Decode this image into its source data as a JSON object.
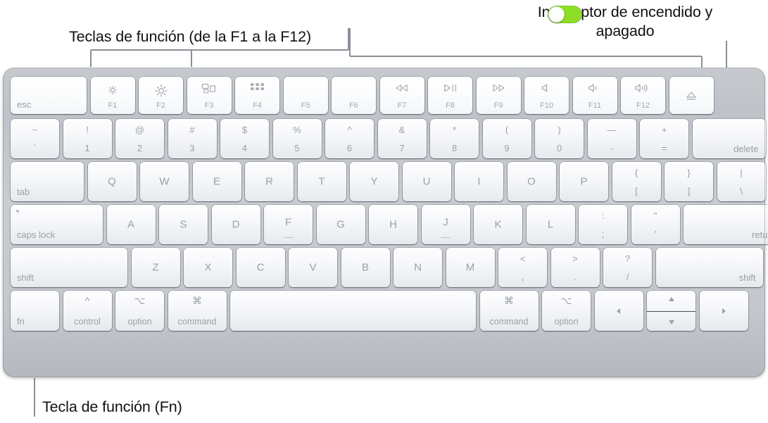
{
  "callouts": {
    "function_keys": "Teclas de función (de la F1 a la F12)",
    "power_switch": "Interruptor de encendido y apagado",
    "fn_key": "Tecla de función (Fn)"
  },
  "toggle": {
    "state": "on",
    "accent_color": "#8ede28",
    "knob_color": "#fdfdfd"
  },
  "colors": {
    "body_top": "#c6c9ce",
    "body_bottom": "#b4b8bf",
    "key_face": "#f7f8fa",
    "key_text": "#9aa0a8",
    "callout_text": "#111111",
    "leader_line": "#8a8f96"
  },
  "keyboard": {
    "rows": [
      {
        "name": "function-row",
        "keys": [
          {
            "id": "esc",
            "label": "esc",
            "style": "bottom-left"
          },
          {
            "id": "f1",
            "icon": "brightness-down-icon",
            "sub": "F1"
          },
          {
            "id": "f2",
            "icon": "brightness-up-icon",
            "sub": "F2"
          },
          {
            "id": "f3",
            "icon": "mission-control-icon",
            "sub": "F3"
          },
          {
            "id": "f4",
            "icon": "launchpad-icon",
            "sub": "F4"
          },
          {
            "id": "f5",
            "icon": "",
            "sub": "F5"
          },
          {
            "id": "f6",
            "icon": "",
            "sub": "F6"
          },
          {
            "id": "f7",
            "icon": "rewind-icon",
            "sub": "F7"
          },
          {
            "id": "f8",
            "icon": "play-pause-icon",
            "sub": "F8"
          },
          {
            "id": "f9",
            "icon": "fast-forward-icon",
            "sub": "F9"
          },
          {
            "id": "f10",
            "icon": "mute-icon",
            "sub": "F10"
          },
          {
            "id": "f11",
            "icon": "volume-down-icon",
            "sub": "F11"
          },
          {
            "id": "f12",
            "icon": "volume-up-icon",
            "sub": "F12"
          },
          {
            "id": "power",
            "icon": "eject-icon",
            "sub": ""
          }
        ]
      },
      {
        "name": "number-row",
        "keys": [
          {
            "id": "backtick",
            "top": "~",
            "bottom": "`"
          },
          {
            "id": "digit-1",
            "top": "!",
            "bottom": "1"
          },
          {
            "id": "digit-2",
            "top": "@",
            "bottom": "2"
          },
          {
            "id": "digit-3",
            "top": "#",
            "bottom": "3"
          },
          {
            "id": "digit-4",
            "top": "$",
            "bottom": "4"
          },
          {
            "id": "digit-5",
            "top": "%",
            "bottom": "5"
          },
          {
            "id": "digit-6",
            "top": "^",
            "bottom": "6"
          },
          {
            "id": "digit-7",
            "top": "&",
            "bottom": "7"
          },
          {
            "id": "digit-8",
            "top": "*",
            "bottom": "8"
          },
          {
            "id": "digit-9",
            "top": "(",
            "bottom": "9"
          },
          {
            "id": "digit-0",
            "top": ")",
            "bottom": "0"
          },
          {
            "id": "minus",
            "top": "—",
            "bottom": "-"
          },
          {
            "id": "equal",
            "top": "+",
            "bottom": "="
          },
          {
            "id": "delete",
            "label": "delete",
            "style": "bottom-right"
          }
        ]
      },
      {
        "name": "tab-row",
        "keys": [
          {
            "id": "tab",
            "label": "tab",
            "style": "bottom-left"
          },
          {
            "id": "key-q",
            "alpha": "Q"
          },
          {
            "id": "key-w",
            "alpha": "W"
          },
          {
            "id": "key-e",
            "alpha": "E"
          },
          {
            "id": "key-r",
            "alpha": "R"
          },
          {
            "id": "key-t",
            "alpha": "T"
          },
          {
            "id": "key-y",
            "alpha": "Y"
          },
          {
            "id": "key-u",
            "alpha": "U"
          },
          {
            "id": "key-i",
            "alpha": "I"
          },
          {
            "id": "key-o",
            "alpha": "O"
          },
          {
            "id": "key-p",
            "alpha": "P"
          },
          {
            "id": "bracket-left",
            "top": "{",
            "bottom": "["
          },
          {
            "id": "bracket-right",
            "top": "}",
            "bottom": "]"
          },
          {
            "id": "backslash",
            "top": "|",
            "bottom": "\\"
          }
        ]
      },
      {
        "name": "home-row",
        "keys": [
          {
            "id": "caps-lock",
            "label": "caps lock",
            "style": "bottom-left",
            "led": true
          },
          {
            "id": "key-a",
            "alpha": "A"
          },
          {
            "id": "key-s",
            "alpha": "S"
          },
          {
            "id": "key-d",
            "alpha": "D"
          },
          {
            "id": "key-f",
            "alpha": "F",
            "homing": true
          },
          {
            "id": "key-g",
            "alpha": "G"
          },
          {
            "id": "key-h",
            "alpha": "H"
          },
          {
            "id": "key-j",
            "alpha": "J",
            "homing": true
          },
          {
            "id": "key-k",
            "alpha": "K"
          },
          {
            "id": "key-l",
            "alpha": "L"
          },
          {
            "id": "semicolon",
            "top": ":",
            "bottom": ";"
          },
          {
            "id": "quote",
            "top": "\"",
            "bottom": "'"
          },
          {
            "id": "return",
            "label": "return",
            "style": "bottom-right"
          }
        ]
      },
      {
        "name": "shift-row",
        "keys": [
          {
            "id": "shift-left",
            "label": "shift",
            "style": "bottom-left"
          },
          {
            "id": "key-z",
            "alpha": "Z"
          },
          {
            "id": "key-x",
            "alpha": "X"
          },
          {
            "id": "key-c",
            "alpha": "C"
          },
          {
            "id": "key-v",
            "alpha": "V"
          },
          {
            "id": "key-b",
            "alpha": "B"
          },
          {
            "id": "key-n",
            "alpha": "N"
          },
          {
            "id": "key-m",
            "alpha": "M"
          },
          {
            "id": "comma",
            "top": "<",
            "bottom": ","
          },
          {
            "id": "period",
            "top": ">",
            "bottom": "."
          },
          {
            "id": "slash",
            "top": "?",
            "bottom": "/"
          },
          {
            "id": "shift-right",
            "label": "shift",
            "style": "bottom-right"
          }
        ]
      },
      {
        "name": "bottom-row",
        "keys": [
          {
            "id": "fn",
            "label": "fn",
            "style": "bottom-left"
          },
          {
            "id": "control-left",
            "sym": "^",
            "label": "control"
          },
          {
            "id": "option-left",
            "sym": "⌥",
            "label": "option"
          },
          {
            "id": "command-left",
            "sym": "⌘",
            "label": "command"
          },
          {
            "id": "space",
            "label": ""
          },
          {
            "id": "command-right",
            "sym": "⌘",
            "label": "command"
          },
          {
            "id": "option-right",
            "sym": "⌥",
            "label": "option"
          },
          {
            "id": "arrow-left",
            "icon": "arrow-left-icon"
          },
          {
            "id": "arrow-up-down",
            "icon": "arrow-up-down-icon"
          },
          {
            "id": "arrow-right",
            "icon": "arrow-right-icon"
          }
        ]
      }
    ]
  }
}
